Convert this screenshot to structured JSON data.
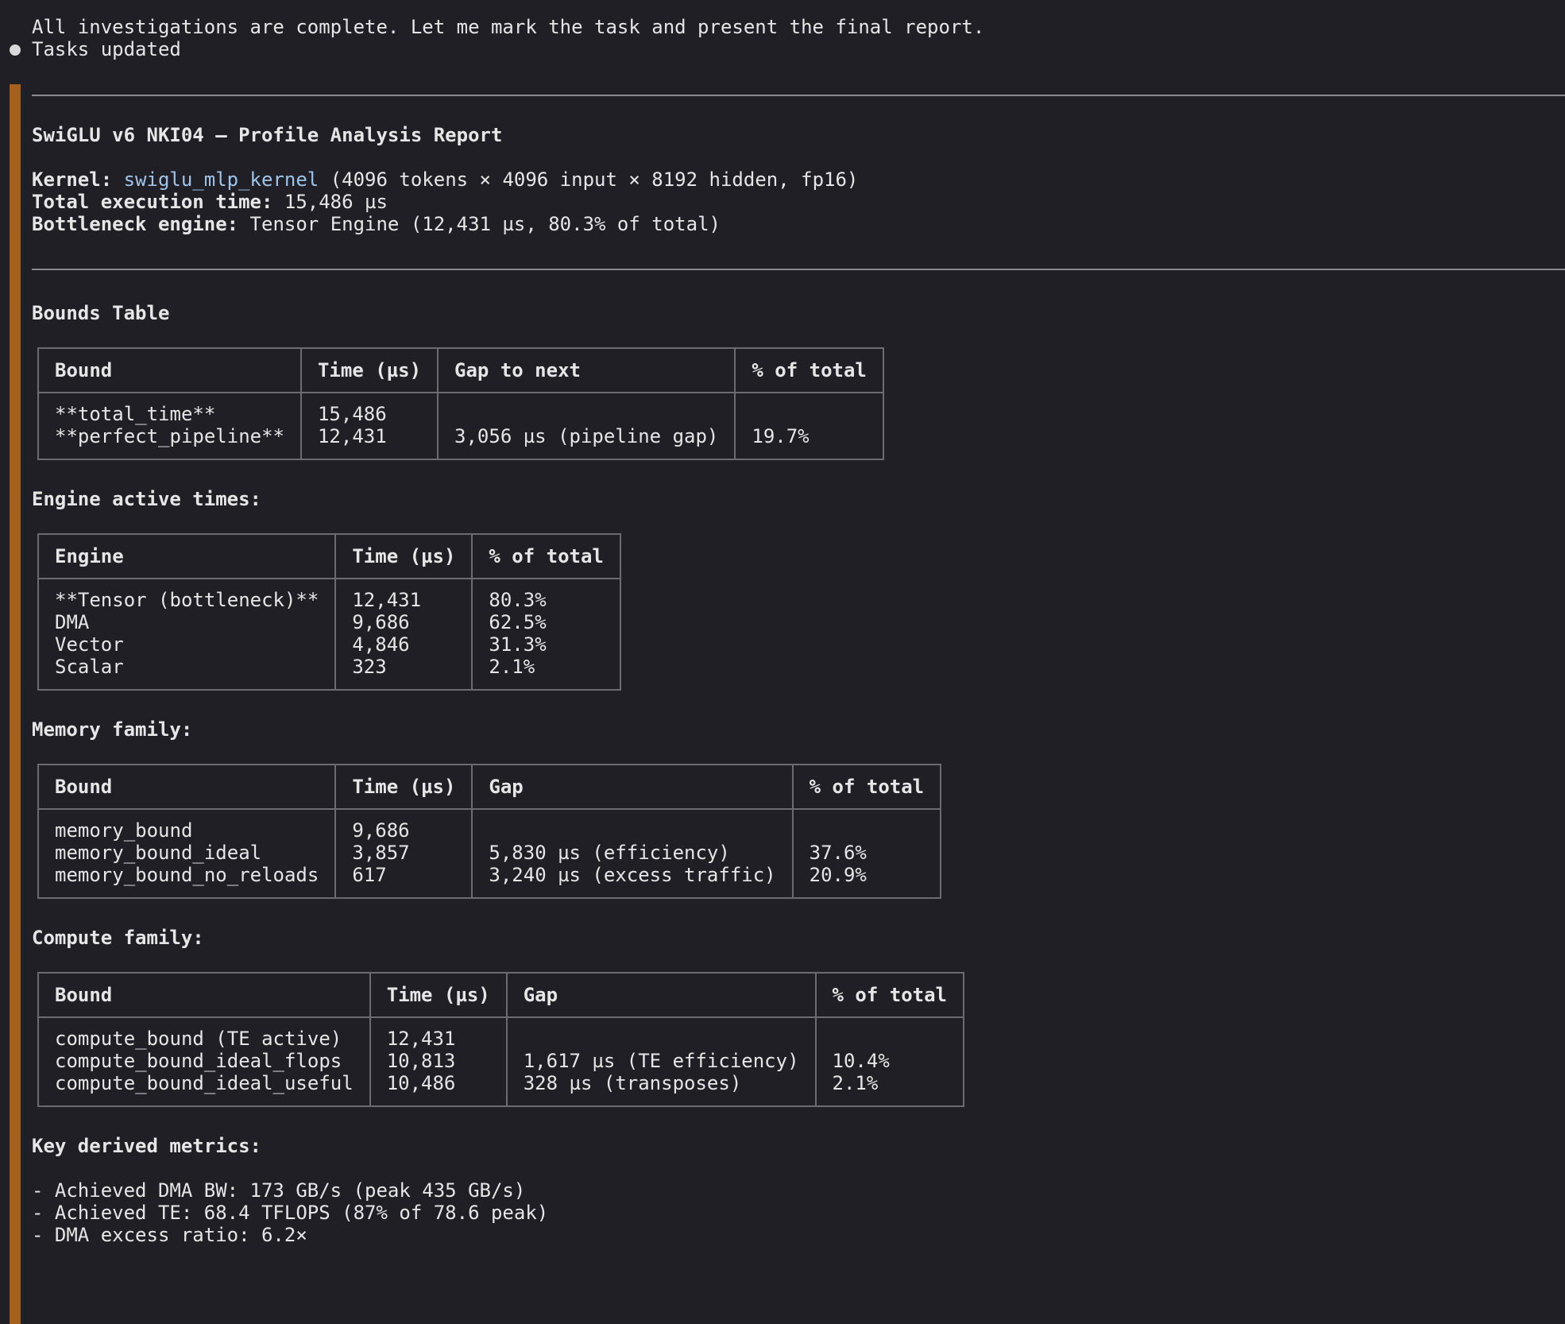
{
  "intro": {
    "line1": "All investigations are complete. Let me mark the task and present the final report.",
    "status": "Tasks updated"
  },
  "report": {
    "title": "SwiGLU v6 NKI04 — Profile Analysis Report",
    "kernel_label": "Kernel:",
    "kernel_name": "swiglu_mlp_kernel",
    "kernel_desc": " (4096 tokens × 4096 input × 8192 hidden, fp16)",
    "exec_label": "Total execution time:",
    "exec_value": " 15,486 µs",
    "bottleneck_label": "Bottleneck engine:",
    "bottleneck_value": " Tensor Engine (12,431 µs, 80.3% of total)"
  },
  "bounds": {
    "heading": "Bounds Table",
    "headers": [
      "Bound",
      "Time (µs)",
      "Gap to next",
      "% of total"
    ],
    "rows": [
      [
        "**total_time**",
        "15,486",
        "",
        ""
      ],
      [
        "**perfect_pipeline**",
        "12,431",
        "3,056 µs (pipeline gap)",
        "19.7%"
      ]
    ]
  },
  "engines": {
    "heading": "Engine active times:",
    "headers": [
      "Engine",
      "Time (µs)",
      "% of total"
    ],
    "rows": [
      [
        "**Tensor (bottleneck)**",
        "12,431",
        "80.3%"
      ],
      [
        "DMA",
        "9,686",
        "62.5%"
      ],
      [
        "Vector",
        "4,846",
        "31.3%"
      ],
      [
        "Scalar",
        "323",
        "2.1%"
      ]
    ]
  },
  "memory": {
    "heading": "Memory family:",
    "headers": [
      "Bound",
      "Time (µs)",
      "Gap",
      "% of total"
    ],
    "rows": [
      [
        "memory_bound",
        "9,686",
        "",
        ""
      ],
      [
        "memory_bound_ideal",
        "3,857",
        "5,830 µs (efficiency)",
        "37.6%"
      ],
      [
        "memory_bound_no_reloads",
        "617",
        "3,240 µs (excess traffic)",
        "20.9%"
      ]
    ]
  },
  "compute": {
    "heading": "Compute family:",
    "headers": [
      "Bound",
      "Time (µs)",
      "Gap",
      "% of total"
    ],
    "rows": [
      [
        "compute_bound (TE active)",
        "12,431",
        "",
        ""
      ],
      [
        "compute_bound_ideal_flops",
        "10,813",
        "1,617 µs (TE efficiency)",
        "10.4%"
      ],
      [
        "compute_bound_ideal_useful",
        "10,486",
        "328 µs (transposes)",
        "2.1%"
      ]
    ]
  },
  "metrics": {
    "heading": "Key derived metrics:",
    "items": [
      "- Achieved DMA BW: 173 GB/s (peak 435 GB/s)",
      "- Achieved TE: 68.4 TFLOPS (87% of 78.6 peak)",
      "- DMA excess ratio: 6.2×"
    ]
  },
  "colors": {
    "background": "#201f26",
    "accent_bar": "#a5601c",
    "link": "#9fc4ea"
  }
}
